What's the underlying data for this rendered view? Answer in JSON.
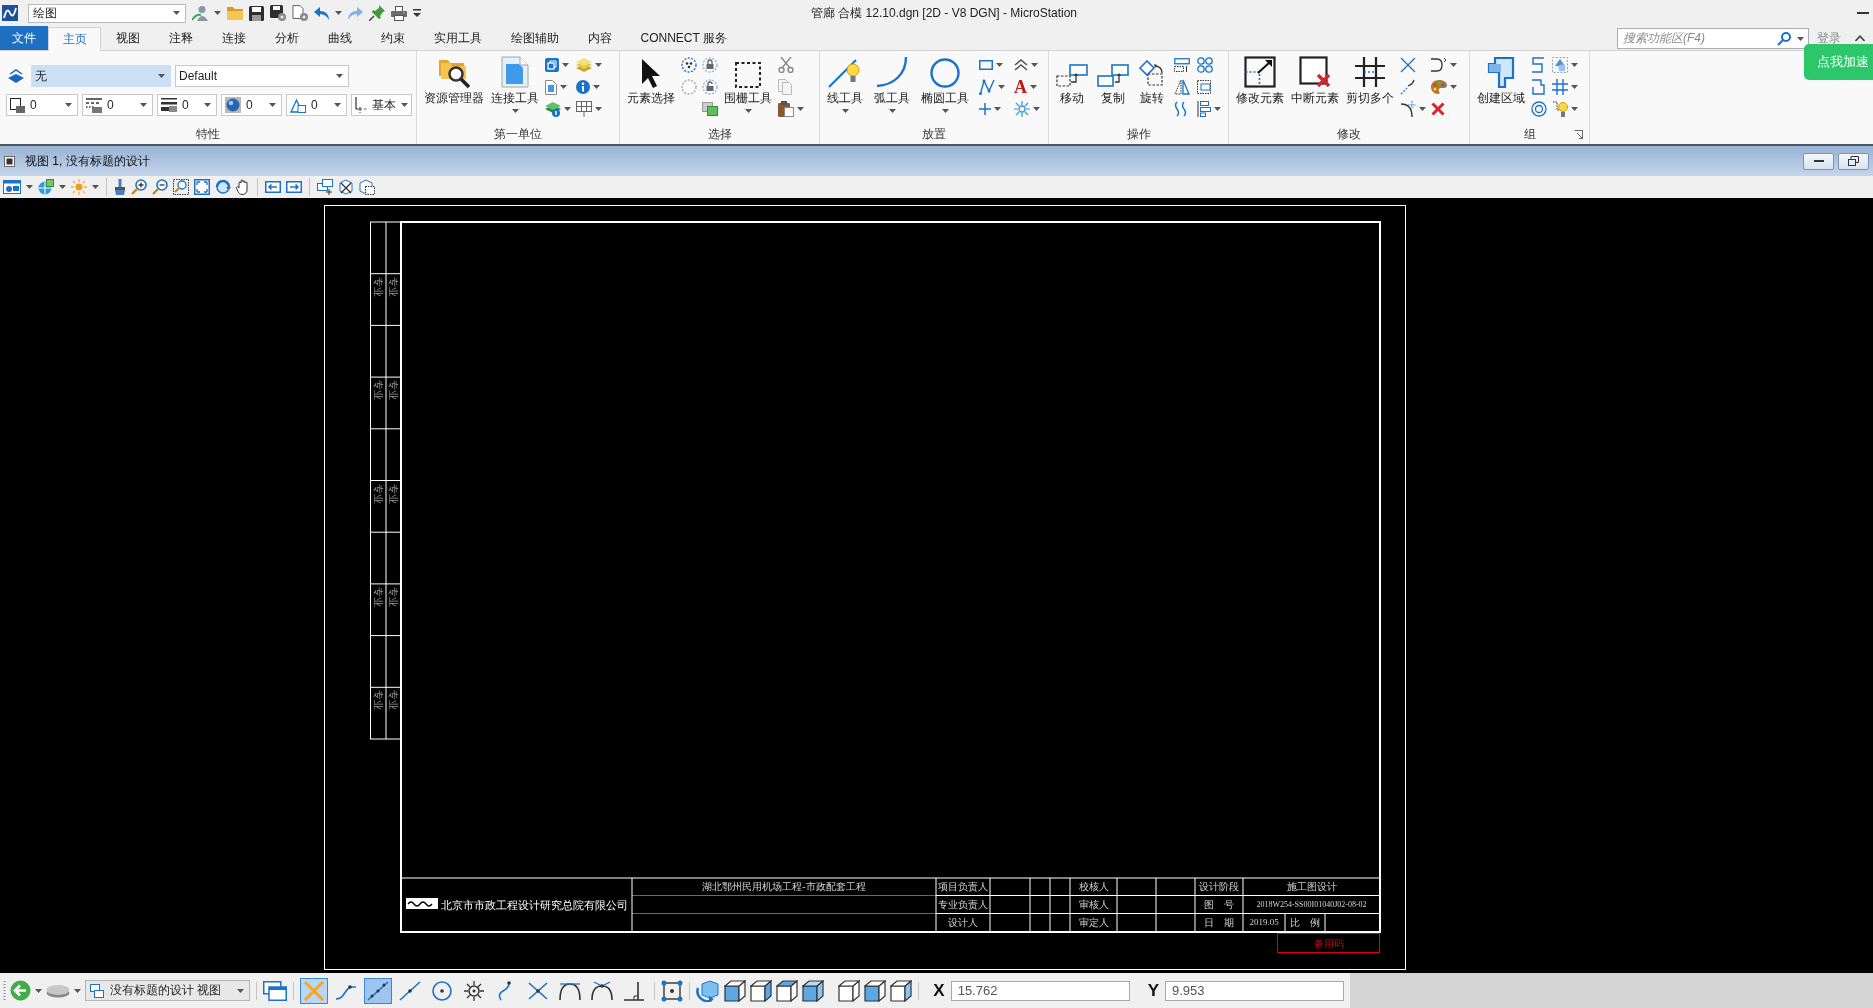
{
  "window": {
    "title": "管廊 合模 12.10.dgn [2D - V8 DGN] - MicroStation"
  },
  "quick_access": {
    "workflow": "绘图"
  },
  "ribbon_tabs": [
    {
      "label": "文件",
      "kind": "backstage",
      "selected": false
    },
    {
      "label": "主页",
      "kind": "tab",
      "selected": true
    },
    {
      "label": "视图",
      "kind": "tab",
      "selected": false
    },
    {
      "label": "注释",
      "kind": "tab",
      "selected": false
    },
    {
      "label": "连接",
      "kind": "tab",
      "selected": false
    },
    {
      "label": "分析",
      "kind": "tab",
      "selected": false
    },
    {
      "label": "曲线",
      "kind": "tab",
      "selected": false
    },
    {
      "label": "约束",
      "kind": "tab",
      "selected": false
    },
    {
      "label": "实用工具",
      "kind": "tab",
      "selected": false
    },
    {
      "label": "绘图辅助",
      "kind": "tab",
      "selected": false
    },
    {
      "label": "内容",
      "kind": "tab",
      "selected": false
    },
    {
      "label": "CONNECT 服务",
      "kind": "tab",
      "selected": false
    }
  ],
  "search": {
    "placeholder": "搜索功能区(F4)"
  },
  "sign_in": "登录",
  "promo_button": "点我加速",
  "ribbon_groups": [
    {
      "label": "特性",
      "kind": "attributes",
      "level": "无",
      "text_style": "Default",
      "symbology": [
        "0",
        "0",
        "0",
        "0",
        "0",
        "基本"
      ]
    },
    {
      "label": "第一单位",
      "kind": "tools",
      "tools": [
        "资源管理器",
        "连接工具"
      ]
    },
    {
      "label": "选择",
      "kind": "tools",
      "tools": [
        "元素选择",
        "围栅工具"
      ]
    },
    {
      "label": "放置",
      "kind": "tools",
      "tools": [
        "线工具",
        "弧工具",
        "椭圆工具"
      ],
      "text_glyph": "A"
    },
    {
      "label": "操作",
      "kind": "tools",
      "tools": [
        "移动",
        "复制",
        "旋转"
      ]
    },
    {
      "label": "修改",
      "kind": "tools",
      "tools": [
        "修改元素",
        "中断元素",
        "剪切多个"
      ]
    },
    {
      "label": "组",
      "kind": "tools",
      "tools": [
        "创建区域"
      ]
    }
  ],
  "view": {
    "title": "视图 1, 没有标题的设计"
  },
  "drawing": {
    "strip_labels": [
      "专业",
      "专业",
      "专业",
      "专业",
      "专业",
      "专业",
      "专业",
      "专业",
      "专业",
      "专业"
    ],
    "title_block": {
      "company": "北京市市政工程设计研究总院有限公司",
      "project": "湖北鄂州民用机场工程-市政配套工程",
      "responsibility_labels": [
        "项目负责人",
        "专业负责人",
        "设计人"
      ],
      "review_labels": [
        "校核人",
        "审核人",
        "审定人"
      ],
      "info": [
        {
          "label": "设计阶段",
          "value": "施工图设计"
        },
        {
          "label": "图　号",
          "value": "2018W254-SS00I01040J02-08-02"
        },
        {
          "label": "日　期",
          "value": "2019.05"
        }
      ],
      "scale_label": "比　例"
    },
    "stamp": "备用码"
  },
  "status_bar": {
    "view_selector": "没有标题的设计 视图",
    "snap_toggle": {
      "on": true
    },
    "snap_modes": [
      {
        "selected": false
      },
      {
        "selected": true
      },
      {
        "selected": false
      },
      {
        "selected": false
      },
      {
        "selected": false
      },
      {
        "selected": false
      },
      {
        "selected": false
      },
      {
        "selected": false
      },
      {
        "selected": false
      },
      {
        "selected": false
      }
    ],
    "x_label": "X",
    "x_value": "15.762",
    "y_label": "Y",
    "y_value": "9.953"
  }
}
